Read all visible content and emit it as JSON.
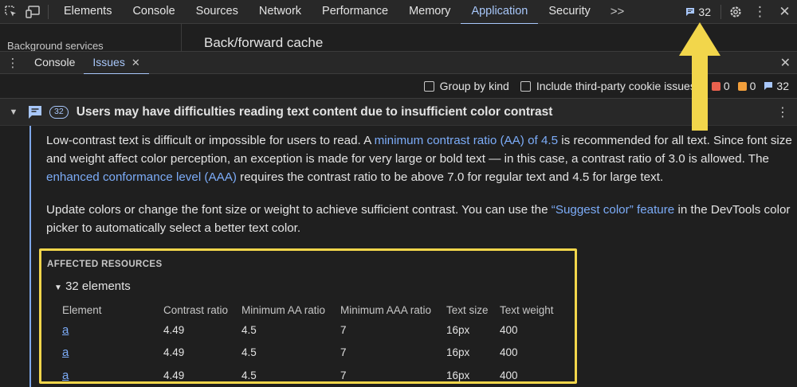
{
  "toolbar": {
    "tabs": [
      "Elements",
      "Console",
      "Sources",
      "Network",
      "Performance",
      "Memory",
      "Application",
      "Security"
    ],
    "active_tab": "Application",
    "more_tabs": ">>",
    "issue_count": "32"
  },
  "main": {
    "sidebar_cutoff_text": "Background services",
    "heading": "Back/forward cache"
  },
  "drawer": {
    "tabs": [
      "Console",
      "Issues"
    ],
    "active_tab": "Issues",
    "group_by_kind_label": "Group by kind",
    "third_party_label": "Include third-party cookie issues",
    "error_count": "0",
    "warning_count": "0",
    "info_count": "32"
  },
  "issue": {
    "count_badge": "32",
    "title": "Users may have difficulties reading text content due to insufficient color contrast",
    "para1_a": "Low-contrast text is difficult or impossible for users to read. A ",
    "para1_link1": "minimum contrast ratio (AA) of 4.5",
    "para1_b": " is recommended for all text. Since font size and weight affect color perception, an exception is made for very large or bold text — in this case, a contrast ratio of 3.0 is allowed. The ",
    "para1_link2": "enhanced conformance level (AAA)",
    "para1_c": " requires the contrast ratio to be above 7.0 for regular text and 4.5 for large text.",
    "para2_a": "Update colors or change the font size or weight to achieve sufficient contrast. You can use the ",
    "para2_link": "“Suggest color” feature",
    "para2_b": " in the DevTools color picker to automatically select a better text color.",
    "resources_title": "AFFECTED RESOURCES",
    "elements_count": "32 elements",
    "columns": [
      "Element",
      "Contrast ratio",
      "Minimum AA ratio",
      "Minimum AAA ratio",
      "Text size",
      "Text weight"
    ],
    "rows": [
      [
        "a",
        "4.49",
        "4.5",
        "7",
        "16px",
        "400"
      ],
      [
        "a",
        "4.49",
        "4.5",
        "7",
        "16px",
        "400"
      ],
      [
        "a",
        "4.49",
        "4.5",
        "7",
        "16px",
        "400"
      ]
    ]
  },
  "colors": {
    "accent": "#a8c7fa",
    "link": "#7cacf8",
    "highlight": "#f2d64b",
    "error": "#e8614e",
    "warning": "#f29f3b"
  }
}
